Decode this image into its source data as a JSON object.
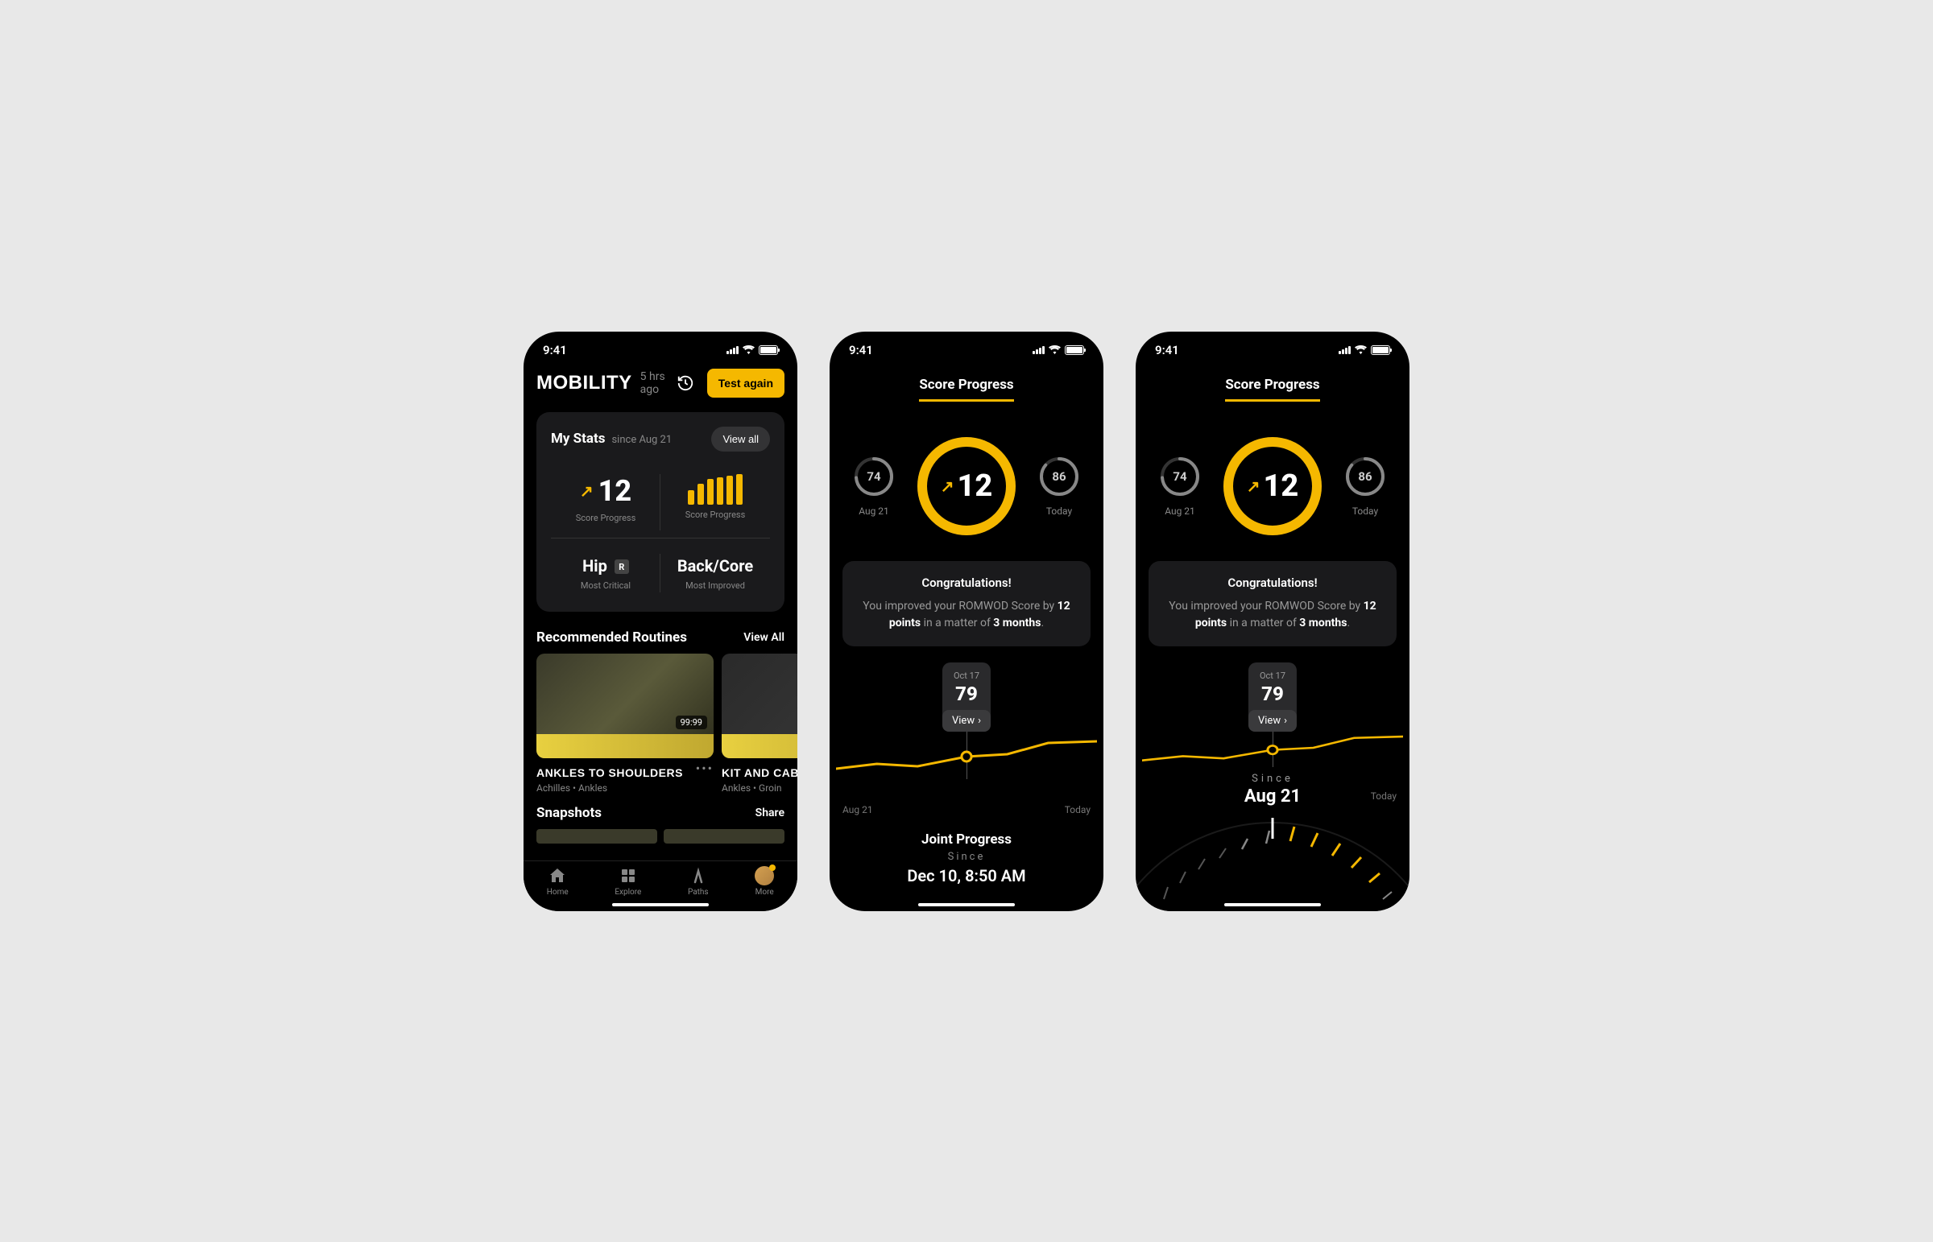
{
  "status": {
    "time": "9:41"
  },
  "colors": {
    "accent": "#f5b800",
    "card": "#1a1a1c"
  },
  "screen1": {
    "title": "MOBILITY",
    "subtitle": "5 hrs ago",
    "test_btn": "Test again",
    "stats": {
      "title": "My Stats",
      "since": "since Aug 21",
      "view_all": "View all",
      "score_progress_label": "Score Progress",
      "score_value": "12",
      "bar_heights": [
        18,
        26,
        32,
        34,
        36,
        38
      ],
      "hip": {
        "title": "Hip",
        "badge": "R",
        "label": "Most Critical"
      },
      "back": {
        "title": "Back/Core",
        "label": "Most Improved"
      }
    },
    "routines": {
      "heading": "Recommended Routines",
      "view_all": "View All",
      "cards": [
        {
          "title": "ANKLES TO SHOULDERS",
          "tags": "Achilles • Ankles",
          "duration": "99:99"
        },
        {
          "title": "KIT AND CABOODLE",
          "tags": "Ankles • Groin"
        }
      ]
    },
    "snapshots": {
      "heading": "Snapshots",
      "share": "Share"
    },
    "tabs": {
      "home": "Home",
      "explore": "Explore",
      "paths": "Paths",
      "more": "More"
    }
  },
  "progress": {
    "title": "Score Progress",
    "left_ring": {
      "value": "74",
      "label": "Aug 21",
      "pct": 74
    },
    "main_ring": {
      "value": "12",
      "pct": 100
    },
    "right_ring": {
      "value": "86",
      "label": "Today",
      "pct": 86
    },
    "congrats": {
      "title": "Congratulations!",
      "line1_pre": "You improved your ROMWOD Score by",
      "points": "12 points",
      "line1_mid": " in a matter of ",
      "months": "3 months",
      "period": "."
    },
    "tooltip": {
      "date": "Oct 17",
      "value": "79",
      "view": "View"
    },
    "chart_labels": {
      "start": "Aug 21",
      "end": "Today"
    },
    "chart_data": {
      "type": "line",
      "x_labels": [
        "Aug 21",
        "",
        "",
        "Oct 17",
        "",
        "",
        "Today"
      ],
      "values": [
        74,
        76,
        75,
        79,
        80,
        84,
        86
      ]
    }
  },
  "screen2_footer": {
    "heading": "Joint Progress",
    "since_label": "Since",
    "since_value": "Dec 10, 8:50 AM"
  },
  "screen3_dial": {
    "since_label": "Since",
    "date": "Aug 21"
  }
}
